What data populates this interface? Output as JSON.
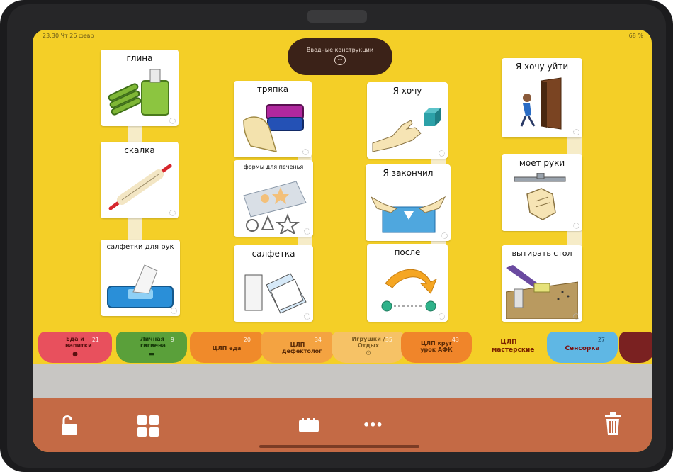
{
  "status_bar": {
    "time": "23:30",
    "date": "Чт 26 февр",
    "battery": "68 %"
  },
  "header_pill": {
    "label": "Вводные конструкции",
    "icon": "speech-bubble-icon"
  },
  "cards": {
    "glina": "глина",
    "skalka": "скалка",
    "salfetki_dlya_ruk": "салфетки для рук",
    "tryapka": "тряпка",
    "formy": "формы для печенья",
    "salfetka": "салфетка",
    "ya_hochu": "Я хочу",
    "ya_zakonchil": "Я закончил",
    "posle": "после",
    "ya_hochu_uiti": "Я хочу уйти",
    "moet_ruki": "моет руки",
    "vytirat_stol": "вытирать стол"
  },
  "tabs": [
    {
      "label": "Еда и напитки",
      "count": "21",
      "color": "#e8505d"
    },
    {
      "label": "Личная гигиена",
      "count": "9",
      "color": "#5aa03a"
    },
    {
      "label": "ЦЛП еда",
      "count": "20",
      "color": "#f08a2a"
    },
    {
      "label": "ЦЛП дефектолог",
      "count": "34",
      "color": "#f4a341"
    },
    {
      "label": "Игрушки / Отдых",
      "count": "35",
      "color": "#f6c266"
    },
    {
      "label": "ЦЛП круг урок АФК",
      "count": "43",
      "color": "#f0852a"
    },
    {
      "label": "ЦЛП мастерские",
      "count": "",
      "color": "#f4cf27"
    },
    {
      "label": "Сенсорка",
      "count": "27",
      "color": "#5fb7e4"
    },
    {
      "label": "",
      "count": "",
      "color": "#7a2121"
    }
  ],
  "toolbar": {
    "lock": "unlock-icon",
    "grid": "grid-icon",
    "keyboard": "keyboard-icon",
    "more": "•••",
    "trash": "trash-icon"
  }
}
